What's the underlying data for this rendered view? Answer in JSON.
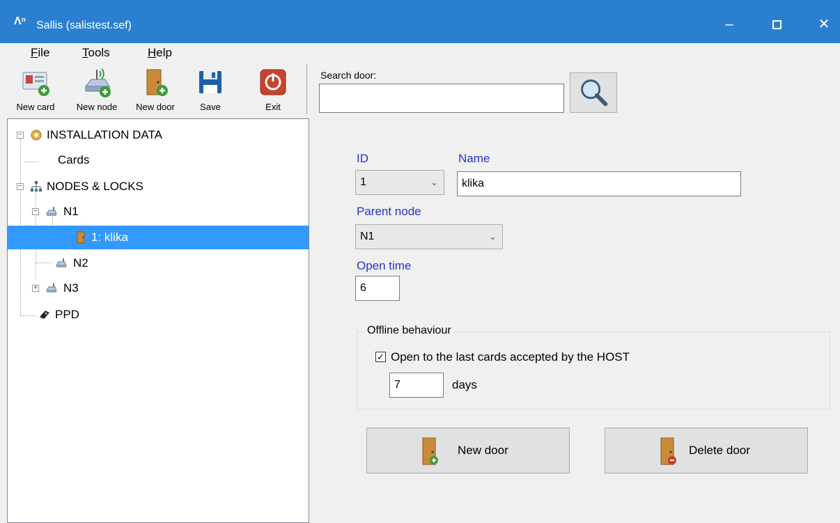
{
  "window": {
    "title": "Sallis (salistest.sef)",
    "app_icon": "sallis-logo"
  },
  "menu": {
    "file": {
      "accel": "F",
      "rest": "ile"
    },
    "tools": {
      "accel": "T",
      "rest": "ools"
    },
    "help": {
      "accel": "H",
      "rest": "elp"
    }
  },
  "toolbar": {
    "new_card": "New card",
    "new_node": "New node",
    "new_door": "New door",
    "save": "Save",
    "exit": "Exit"
  },
  "tree": {
    "installation": "INSTALLATION DATA",
    "cards": "Cards",
    "nodes_locks": "NODES & LOCKS",
    "n1": "N1",
    "door_klika": "1: klika",
    "n2": "N2",
    "n3": "N3",
    "ppd": "PPD"
  },
  "search": {
    "label": "Search door:",
    "value": ""
  },
  "form": {
    "id_label": "ID",
    "id_value": "1",
    "name_label": "Name",
    "name_value": "klika",
    "parent_label": "Parent node",
    "parent_value": "N1",
    "open_time_label": "Open time",
    "open_time_value": "6"
  },
  "offline": {
    "legend": "Offline behaviour",
    "checkbox_label": "Open to the last cards accepted by the HOST",
    "checked": true,
    "days_value": "7",
    "days_label": "days"
  },
  "buttons": {
    "new_door": "New door",
    "delete_door": "Delete door"
  },
  "colors": {
    "titlebar": "#2b7fd0",
    "selection": "#3399ff",
    "field_label": "#2233cc"
  }
}
